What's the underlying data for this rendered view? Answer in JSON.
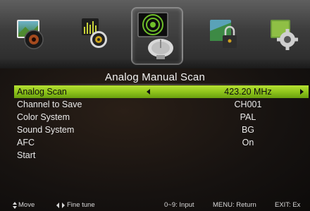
{
  "menu_icons": [
    {
      "name": "picture-icon",
      "active": false
    },
    {
      "name": "sound-icon",
      "active": false
    },
    {
      "name": "channel-icon",
      "active": true
    },
    {
      "name": "lock-icon",
      "active": false
    },
    {
      "name": "setup-icon",
      "active": false
    }
  ],
  "title": "Analog Manual Scan",
  "rows": [
    {
      "label": "Analog Scan",
      "value": "423.20 MHz",
      "selected": true
    },
    {
      "label": "Channel to Save",
      "value": "CH001"
    },
    {
      "label": "Color System",
      "value": "PAL"
    },
    {
      "label": "Sound System",
      "value": "BG"
    },
    {
      "label": "AFC",
      "value": "On"
    },
    {
      "label": "Start",
      "value": ""
    }
  ],
  "footer": {
    "move": "Move",
    "fine_tune": "Fine tune",
    "input": "0~9: Input",
    "menu": "MENU: Return",
    "exit": "EXIT: Ex"
  },
  "colors": {
    "highlight": "#9ccf22",
    "background": "#161210"
  }
}
